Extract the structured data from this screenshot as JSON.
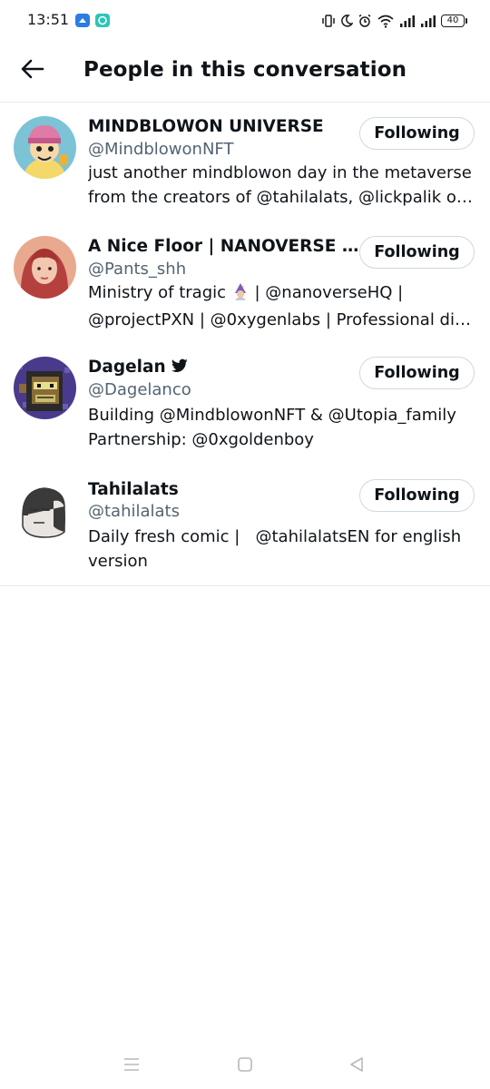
{
  "status_bar": {
    "time": "13:51",
    "battery": "40",
    "icons": [
      "app-notification-icon",
      "chat-notification-icon",
      "vibrate-icon",
      "moon-icon",
      "alarm-icon",
      "wifi-icon",
      "signal-icon",
      "signal-icon",
      "battery-icon"
    ]
  },
  "header": {
    "title": "People in this conversation",
    "back_icon": "arrow-left-icon"
  },
  "people": [
    {
      "name": "MINDBLOWON UNIVERSE",
      "handle": "@MindblowonNFT",
      "bio_lines": [
        "just another mindblowon day in the metaverse",
        "from the creators of @tahilalats, @lickpalik of..."
      ],
      "button": "Following"
    },
    {
      "name": "A Nice Floor | NANOVERSE Le...",
      "handle": "@Pants_shh",
      "bio_lines": [
        "Ministry of tragic",
        "| @nanoverseHQ |",
        "@projectPXN | @0xygenlabs | Professional dis..."
      ],
      "button": "Following"
    },
    {
      "name": "Dagelan",
      "handle": "@Dagelanco",
      "bio_lines": [
        "Building @MindblowonNFT & @Utopia_family",
        "Partnership: @0xgoldenboy"
      ],
      "button": "Following",
      "badge_icon": "twitter-bird-icon"
    },
    {
      "name": "Tahilalats",
      "handle": "@tahilalats",
      "bio_lines": [
        "Daily fresh comic |   @tahilalatsEN for english",
        "version"
      ],
      "button": "Following"
    }
  ],
  "nav_bar": {
    "icons": [
      "menu-icon",
      "home-square-icon",
      "back-triangle-icon"
    ]
  },
  "colors": {
    "text_primary": "#0f1419",
    "text_secondary": "#536471",
    "divider": "#e6e9eb",
    "button_border": "#cfd9de"
  }
}
